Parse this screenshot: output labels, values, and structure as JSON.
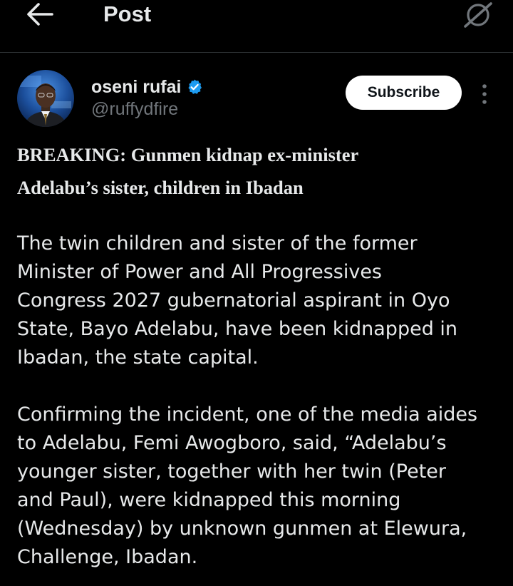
{
  "topbar": {
    "title": "Post",
    "back_icon": "arrow-left-icon",
    "grok_icon": "grok-icon"
  },
  "author": {
    "name": "oseni rufai",
    "handle": "@ruffydfire",
    "verified_icon": "verified-badge-icon",
    "verified_color": "#1d9bf0"
  },
  "actions": {
    "subscribe_label": "Subscribe",
    "more_icon": "more-vertical-icon"
  },
  "post": {
    "headline_lines": [
      "BREAKING: Gunmen kidnap ex-minister",
      "Adelabu’s sister, children in Ibadan"
    ],
    "paragraph1_lines": [
      "The twin children and sister of the former",
      "Minister of Power and All Progressives",
      "Congress 2027 gubernatorial aspirant in Oyo",
      "State, Bayo Adelabu, have been kidnapped in",
      "Ibadan, the state capital."
    ],
    "paragraph2_lines": [
      "Confirming the incident, one of the media aides",
      "to Adelabu, Femi Awogboro, said, “Adelabu’s",
      "younger sister, together with her twin (Peter",
      "and Paul), were kidnapped this morning",
      "(Wednesday) by unknown gunmen at Elewura,",
      "Challenge, Ibadan."
    ]
  },
  "colors": {
    "background": "#000000",
    "text": "#e7e9ea",
    "secondary_text": "#71767b",
    "divider": "#2f3336",
    "accent": "#1d9bf0"
  }
}
